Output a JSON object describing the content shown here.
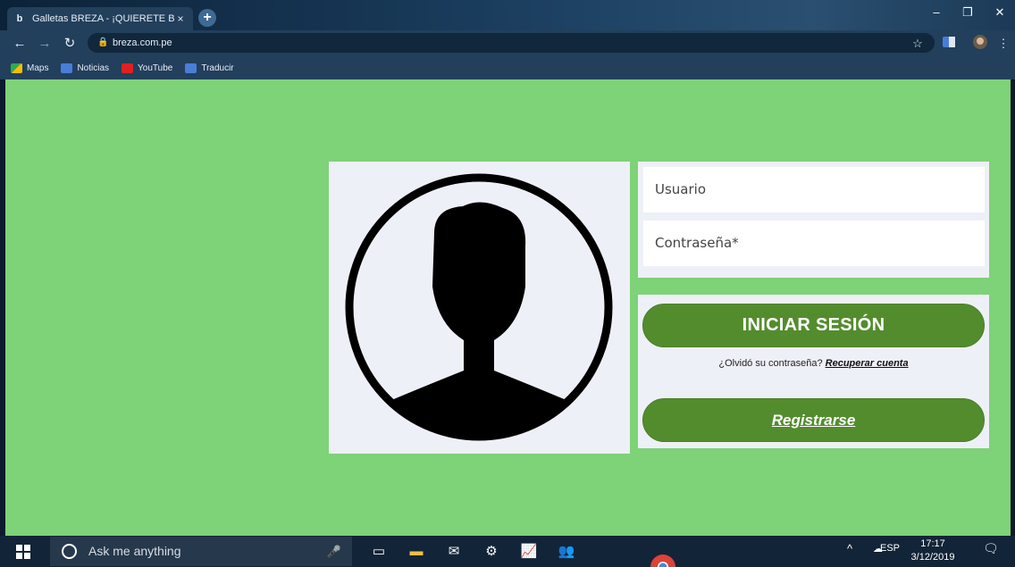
{
  "browser": {
    "tab_title": "Galletas BREZA - ¡QUIERETE BIEN",
    "tab_favicon": "b",
    "url": "breza.com.pe",
    "bookmarks": [
      {
        "label": "Maps",
        "icon": "maps-icon",
        "color": "#4caf50"
      },
      {
        "label": "Noticias",
        "icon": "news-icon",
        "color": "#4a7dd8"
      },
      {
        "label": "YouTube",
        "icon": "youtube-icon",
        "color": "#e02020"
      },
      {
        "label": "Traducir",
        "icon": "translate-icon",
        "color": "#4a7dd8"
      }
    ]
  },
  "login": {
    "username_placeholder": "Usuario",
    "password_placeholder": "Contraseña*",
    "login_button": "INICIAR SESIÓN",
    "forgot_text": "¿Olvidó su contraseña?",
    "recover_link": "Recuperar cuenta",
    "register_button": "Registrarse"
  },
  "taskbar": {
    "search_placeholder": "Ask me anything",
    "language": "ESP",
    "time": "17:17",
    "date": "3/12/2019"
  },
  "colors": {
    "page_background": "#7ed277",
    "button": "#538c2d",
    "panel": "#eef0f7"
  }
}
